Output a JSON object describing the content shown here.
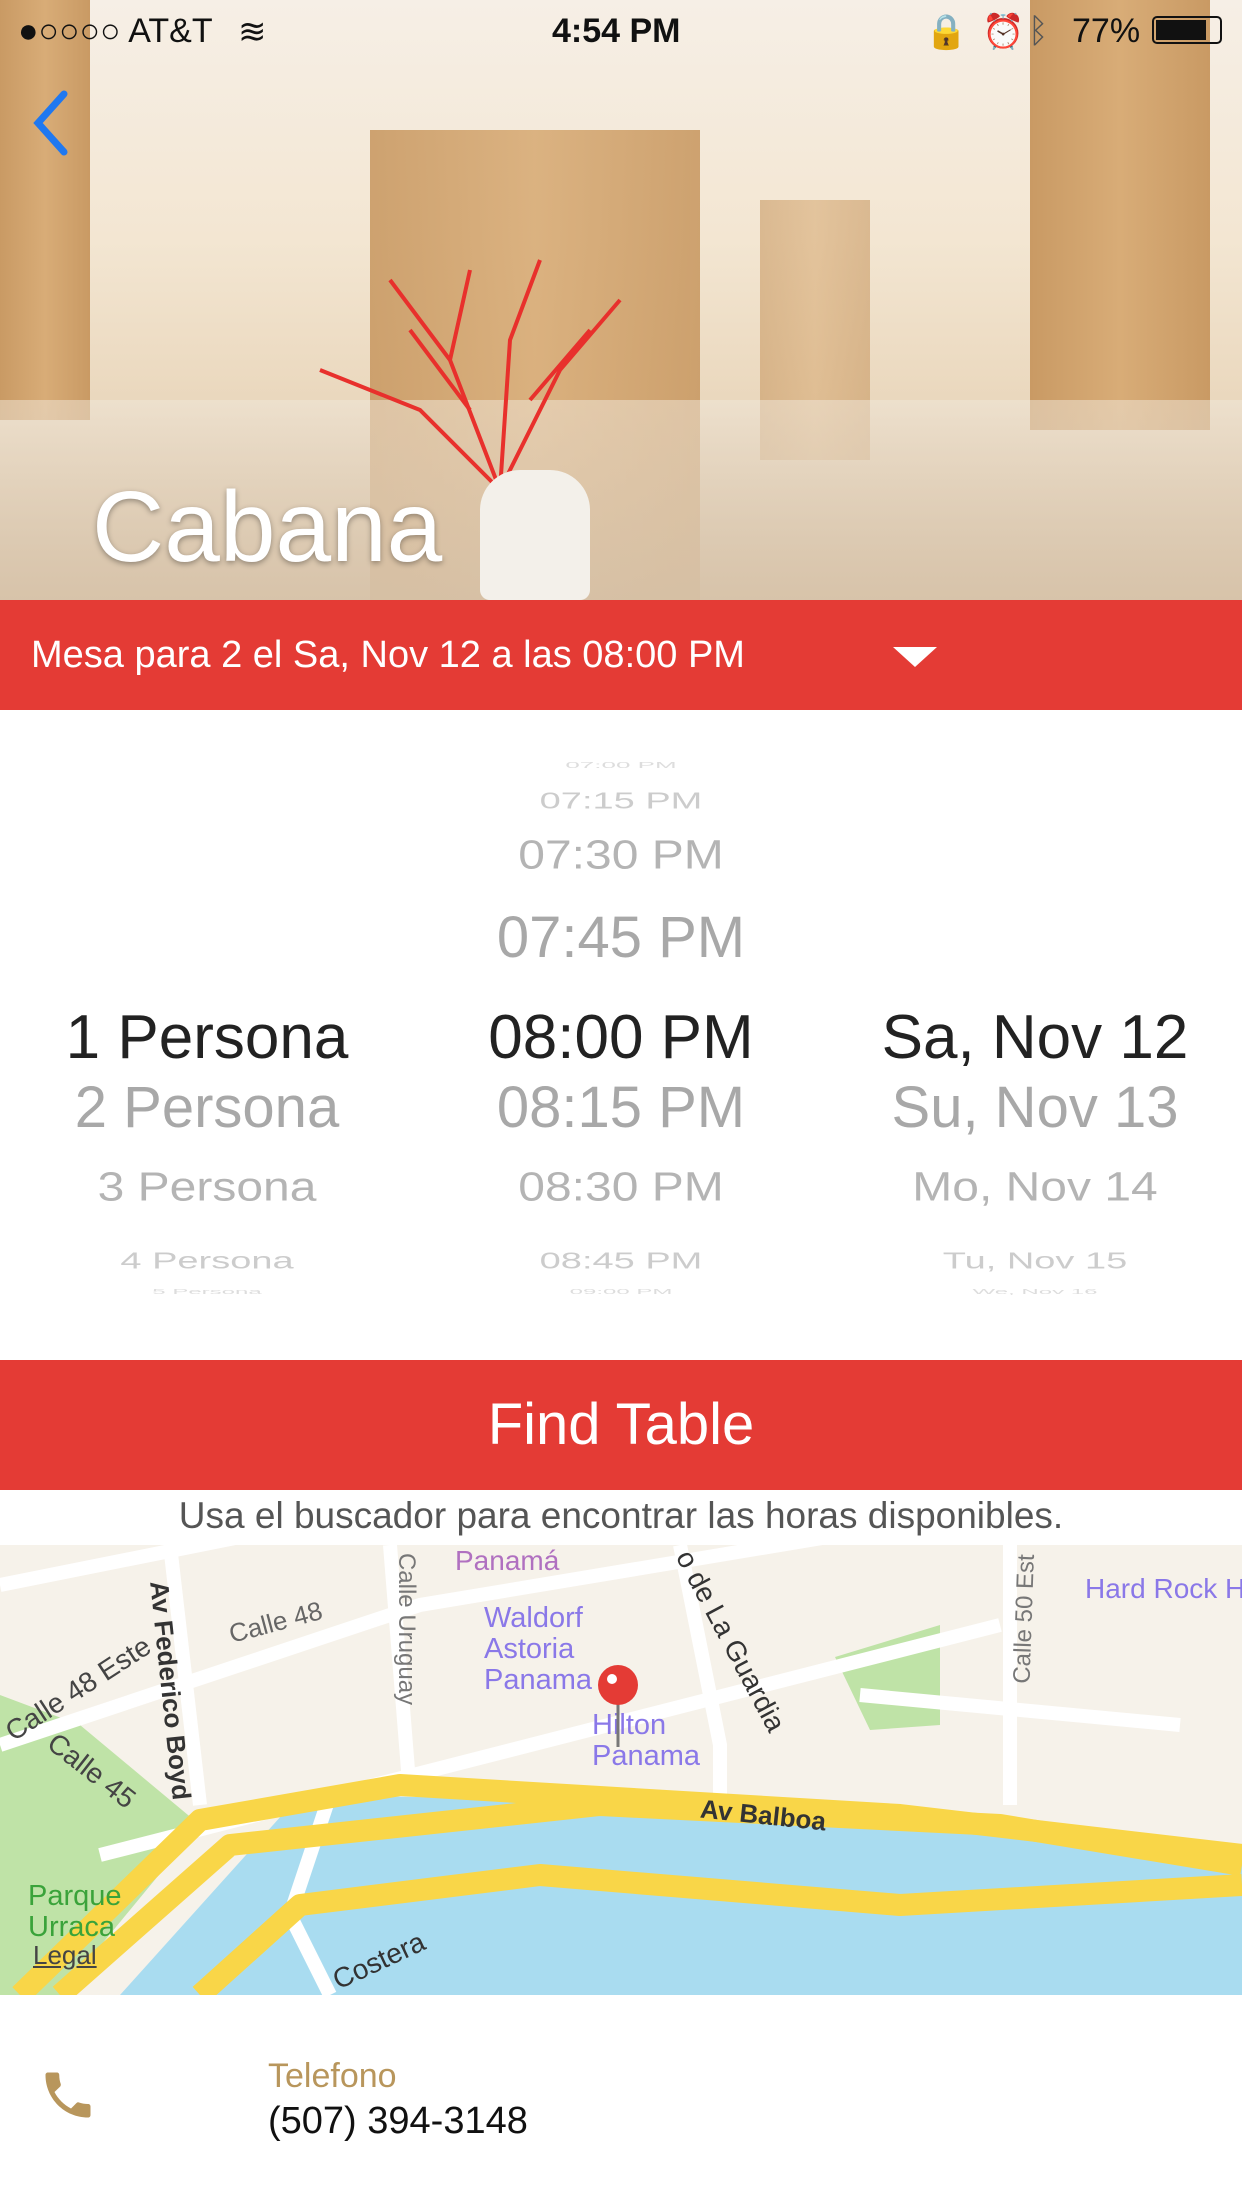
{
  "status_bar": {
    "carrier": "●○○○○ AT&T",
    "time": "4:54 PM",
    "battery": "77%"
  },
  "header": {
    "title": "Cabana",
    "back_icon": "chevron-left-icon"
  },
  "reservation_bar": {
    "summary": "Mesa para 2 el Sa, Nov 12 a las 08:00 PM",
    "icon": "dropdown-triangle-icon"
  },
  "picker": {
    "party": {
      "items": [
        "1 Persona",
        "2 Persona",
        "3 Persona",
        "4 Persona",
        "5 Persona"
      ],
      "selected": "1 Persona"
    },
    "time": {
      "items": [
        "07:00 PM",
        "07:15 PM",
        "07:30 PM",
        "07:45 PM",
        "08:00 PM",
        "08:15 PM",
        "08:30 PM",
        "08:45 PM",
        "09:00 PM"
      ],
      "selected": "08:00 PM"
    },
    "date": {
      "items": [
        "Sa, Nov 12",
        "Su, Nov 13",
        "Mo, Nov 14",
        "Tu, Nov 15",
        "We, Nov 16"
      ],
      "selected": "Sa, Nov 12"
    }
  },
  "find_button": "Find Table",
  "hint": "Usa el buscador para encontrar las horas disponibles.",
  "map": {
    "labels": {
      "altabar": "Panamá",
      "calle48": "Calle 48",
      "calle48este": "Calle 48 Este",
      "federico": "Av Federico Boyd",
      "uruguay": "Calle Uruguay",
      "guardia": "o de La Guardia",
      "calle50": "Calle 50 Est",
      "waldorf": "Waldorf Astoria Panama",
      "hilton": "Hilton Panama",
      "hardrock": "Hard Rock Hotel Panamá Megapolis",
      "calle45": "Calle 45",
      "balboa": "Av Balboa",
      "parque": "Parque Urraca",
      "costera": "Costera",
      "legal": "Legal"
    }
  },
  "contact": {
    "label": "Telefono",
    "phone": "(507) 394-3148",
    "icon": "phone-icon"
  },
  "colors": {
    "accent": "#e43b35",
    "gold": "#b8965c"
  }
}
